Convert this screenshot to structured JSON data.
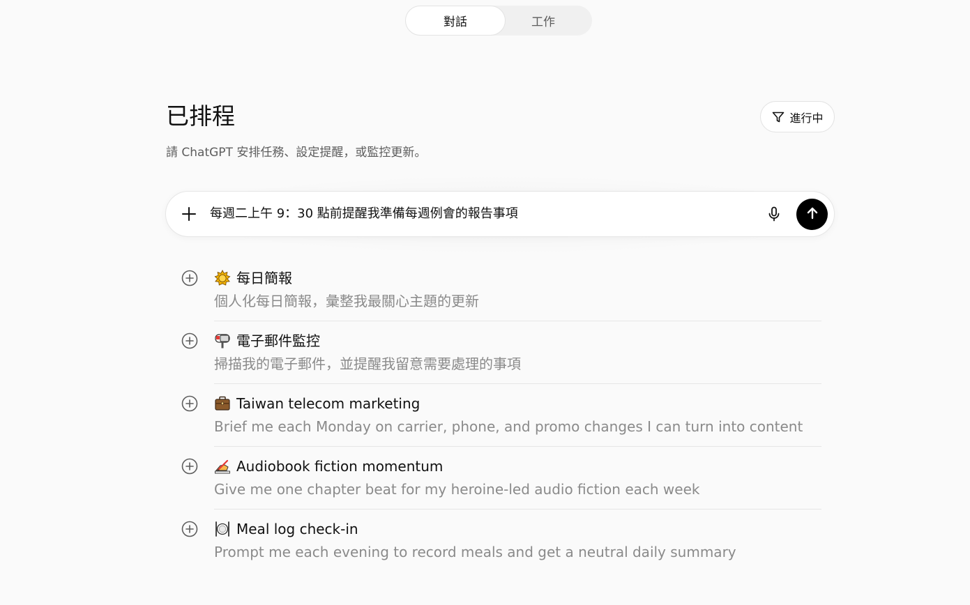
{
  "mode_toggle": {
    "active_label": "對話",
    "inactive_label": "工作"
  },
  "header": {
    "title": "已排程",
    "subtitle": "請 ChatGPT 安排任務、設定提醒，或監控更新。",
    "filter_label": "進行中"
  },
  "composer": {
    "value": "每週二上午 9：30 點前提醒我準備每週例會的報告事項"
  },
  "suggestions": [
    {
      "icon": "sun-icon",
      "title": "每日簡報",
      "description": "個人化每日簡報，彙整我最關心主題的更新"
    },
    {
      "icon": "mailbox-icon",
      "title": "電子郵件監控",
      "description": "掃描我的電子郵件，並提醒我留意需要處理的事項"
    },
    {
      "icon": "briefcase-icon",
      "title": "Taiwan telecom marketing",
      "description": "Brief me each Monday on carrier, phone, and promo changes I can turn into content"
    },
    {
      "icon": "writing-hand-icon",
      "title": "Audiobook fiction momentum",
      "description": "Give me one chapter beat for my heroine-led audio fiction each week"
    },
    {
      "icon": "plate-utensils-icon",
      "title": "Meal log check-in",
      "description": "Prompt me each evening to record meals and get a neutral daily summary"
    }
  ],
  "colors": {
    "background": "#fafafa",
    "send_button": "#000000",
    "muted_text": "#8a8a8a"
  }
}
